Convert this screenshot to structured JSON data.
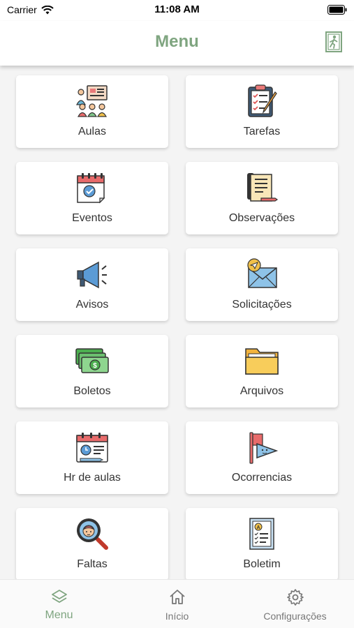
{
  "status_bar": {
    "carrier": "Carrier",
    "time": "11:08 AM"
  },
  "header": {
    "title": "Menu",
    "exit_icon": "exit-door-icon"
  },
  "menu_items": [
    {
      "label": "Aulas",
      "icon": "classroom-icon"
    },
    {
      "label": "Tarefas",
      "icon": "clipboard-checklist-icon"
    },
    {
      "label": "Eventos",
      "icon": "calendar-check-icon"
    },
    {
      "label": "Observações",
      "icon": "notes-scroll-icon"
    },
    {
      "label": "Avisos",
      "icon": "megaphone-icon"
    },
    {
      "label": "Solicitações",
      "icon": "envelope-send-icon"
    },
    {
      "label": "Boletos",
      "icon": "money-bills-icon"
    },
    {
      "label": "Arquivos",
      "icon": "folder-icon"
    },
    {
      "label": "Hr de aulas",
      "icon": "schedule-calendar-icon"
    },
    {
      "label": "Ocorrencias",
      "icon": "flag-icon"
    },
    {
      "label": "Faltas",
      "icon": "magnifier-student-icon"
    },
    {
      "label": "Boletim",
      "icon": "report-card-icon"
    }
  ],
  "tab_bar": {
    "tabs": [
      {
        "label": "Menu",
        "icon": "layers-icon",
        "active": true
      },
      {
        "label": "Início",
        "icon": "home-icon",
        "active": false
      },
      {
        "label": "Configurações",
        "icon": "gear-icon",
        "active": false
      }
    ]
  },
  "colors": {
    "accent": "#7fa580",
    "inactive": "#777777",
    "background": "#f4f4f4"
  }
}
